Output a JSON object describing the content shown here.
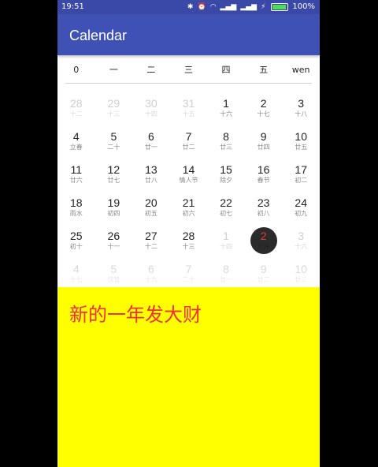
{
  "status": {
    "time": "19:51",
    "battery": "100%",
    "battery_level": 1.0
  },
  "app": {
    "title": "Calendar"
  },
  "weekdays": [
    "0",
    "一",
    "二",
    "三",
    "四",
    "五",
    "wen"
  ],
  "today_index": 33,
  "days": [
    {
      "day": "28",
      "lunar": "十二",
      "other": true
    },
    {
      "day": "29",
      "lunar": "十三",
      "other": true
    },
    {
      "day": "30",
      "lunar": "十四",
      "other": true
    },
    {
      "day": "31",
      "lunar": "十五",
      "other": true
    },
    {
      "day": "1",
      "lunar": "十六",
      "other": false
    },
    {
      "day": "2",
      "lunar": "十七",
      "other": false
    },
    {
      "day": "3",
      "lunar": "十八",
      "other": false
    },
    {
      "day": "4",
      "lunar": "立春",
      "other": false
    },
    {
      "day": "5",
      "lunar": "二十",
      "other": false
    },
    {
      "day": "6",
      "lunar": "廿一",
      "other": false
    },
    {
      "day": "7",
      "lunar": "廿二",
      "other": false
    },
    {
      "day": "8",
      "lunar": "廿三",
      "other": false
    },
    {
      "day": "9",
      "lunar": "廿四",
      "other": false
    },
    {
      "day": "10",
      "lunar": "廿五",
      "other": false
    },
    {
      "day": "11",
      "lunar": "廿六",
      "other": false
    },
    {
      "day": "12",
      "lunar": "廿七",
      "other": false
    },
    {
      "day": "13",
      "lunar": "廿八",
      "other": false
    },
    {
      "day": "14",
      "lunar": "情人节",
      "other": false
    },
    {
      "day": "15",
      "lunar": "除夕",
      "other": false
    },
    {
      "day": "16",
      "lunar": "春节",
      "other": false
    },
    {
      "day": "17",
      "lunar": "初二",
      "other": false
    },
    {
      "day": "18",
      "lunar": "雨水",
      "other": false
    },
    {
      "day": "19",
      "lunar": "初四",
      "other": false
    },
    {
      "day": "20",
      "lunar": "初五",
      "other": false
    },
    {
      "day": "21",
      "lunar": "初六",
      "other": false
    },
    {
      "day": "22",
      "lunar": "初七",
      "other": false
    },
    {
      "day": "23",
      "lunar": "初八",
      "other": false
    },
    {
      "day": "24",
      "lunar": "初九",
      "other": false
    },
    {
      "day": "25",
      "lunar": "初十",
      "other": false
    },
    {
      "day": "26",
      "lunar": "十一",
      "other": false
    },
    {
      "day": "27",
      "lunar": "十二",
      "other": false
    },
    {
      "day": "28",
      "lunar": "十三",
      "other": false
    },
    {
      "day": "1",
      "lunar": "十四",
      "other": true
    },
    {
      "day": "2",
      "lunar": "元宵",
      "other": true
    },
    {
      "day": "3",
      "lunar": "十六",
      "other": true
    },
    {
      "day": "4",
      "lunar": "十七",
      "other": true
    },
    {
      "day": "5",
      "lunar": "惊蛰",
      "other": true
    },
    {
      "day": "6",
      "lunar": "十九",
      "other": true
    },
    {
      "day": "7",
      "lunar": "二十",
      "other": true
    },
    {
      "day": "8",
      "lunar": "廿一",
      "other": true
    },
    {
      "day": "9",
      "lunar": "廿二",
      "other": true
    },
    {
      "day": "10",
      "lunar": "廿三",
      "other": true
    }
  ],
  "message": "新的一年发大财",
  "colors": {
    "appbar": "#3f51b5",
    "highlight": "#ffff00",
    "message": "#f0303a",
    "today": "#e53935"
  }
}
